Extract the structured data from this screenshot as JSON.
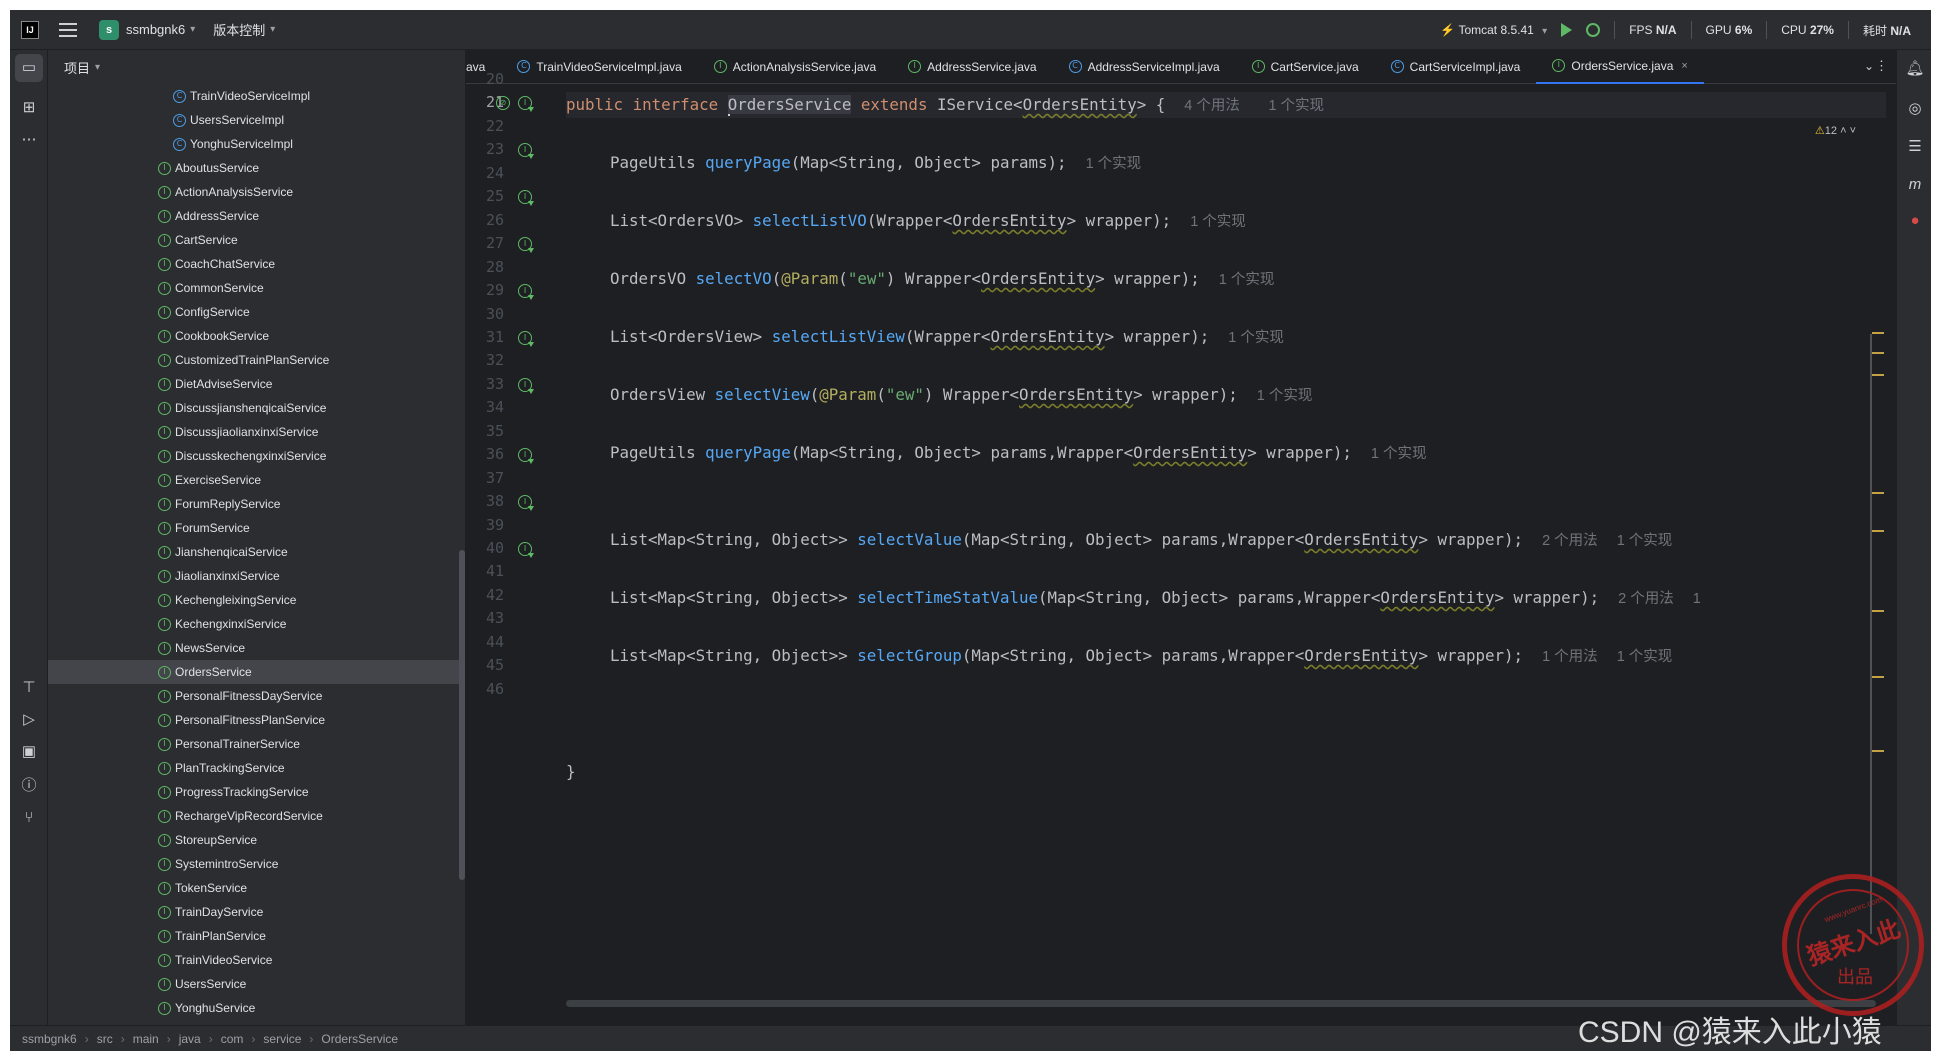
{
  "titlebar": {
    "project_initial": "s",
    "project_name": "ssmbgnk6",
    "vcs_label": "版本控制",
    "run_config": "Tomcat 8.5.41",
    "fps_label": "FPS",
    "fps_value": "N/A",
    "gpu_label": "GPU",
    "gpu_value": "6%",
    "cpu_label": "CPU",
    "cpu_value": "27%",
    "time_label": "耗时",
    "time_value": "N/A"
  },
  "project_panel": {
    "title": "项目",
    "items": [
      {
        "label": "TrainVideoServiceImpl",
        "kind": "class",
        "indent": 2
      },
      {
        "label": "UsersServiceImpl",
        "kind": "class",
        "indent": 2
      },
      {
        "label": "YonghuServiceImpl",
        "kind": "class",
        "indent": 2
      },
      {
        "label": "AboutusService",
        "kind": "interface",
        "indent": 1
      },
      {
        "label": "ActionAnalysisService",
        "kind": "interface",
        "indent": 1
      },
      {
        "label": "AddressService",
        "kind": "interface",
        "indent": 1
      },
      {
        "label": "CartService",
        "kind": "interface",
        "indent": 1
      },
      {
        "label": "CoachChatService",
        "kind": "interface",
        "indent": 1
      },
      {
        "label": "CommonService",
        "kind": "interface",
        "indent": 1
      },
      {
        "label": "ConfigService",
        "kind": "interface",
        "indent": 1
      },
      {
        "label": "CookbookService",
        "kind": "interface",
        "indent": 1
      },
      {
        "label": "CustomizedTrainPlanService",
        "kind": "interface",
        "indent": 1
      },
      {
        "label": "DietAdviseService",
        "kind": "interface",
        "indent": 1
      },
      {
        "label": "DiscussjianshenqicaiService",
        "kind": "interface",
        "indent": 1
      },
      {
        "label": "DiscussjiaolianxinxiService",
        "kind": "interface",
        "indent": 1
      },
      {
        "label": "DiscusskechengxinxiService",
        "kind": "interface",
        "indent": 1
      },
      {
        "label": "ExerciseService",
        "kind": "interface",
        "indent": 1
      },
      {
        "label": "ForumReplyService",
        "kind": "interface",
        "indent": 1
      },
      {
        "label": "ForumService",
        "kind": "interface",
        "indent": 1
      },
      {
        "label": "JianshenqicaiService",
        "kind": "interface",
        "indent": 1
      },
      {
        "label": "JiaolianxinxiService",
        "kind": "interface",
        "indent": 1
      },
      {
        "label": "KechengleixingService",
        "kind": "interface",
        "indent": 1
      },
      {
        "label": "KechengxinxiService",
        "kind": "interface",
        "indent": 1
      },
      {
        "label": "NewsService",
        "kind": "interface",
        "indent": 1
      },
      {
        "label": "OrdersService",
        "kind": "interface",
        "indent": 1,
        "selected": true
      },
      {
        "label": "PersonalFitnessDayService",
        "kind": "interface",
        "indent": 1
      },
      {
        "label": "PersonalFitnessPlanService",
        "kind": "interface",
        "indent": 1
      },
      {
        "label": "PersonalTrainerService",
        "kind": "interface",
        "indent": 1
      },
      {
        "label": "PlanTrackingService",
        "kind": "interface",
        "indent": 1
      },
      {
        "label": "ProgressTrackingService",
        "kind": "interface",
        "indent": 1
      },
      {
        "label": "RechargeVipRecordService",
        "kind": "interface",
        "indent": 1
      },
      {
        "label": "StoreupService",
        "kind": "interface",
        "indent": 1
      },
      {
        "label": "SystemintroService",
        "kind": "interface",
        "indent": 1
      },
      {
        "label": "TokenService",
        "kind": "interface",
        "indent": 1
      },
      {
        "label": "TrainDayService",
        "kind": "interface",
        "indent": 1
      },
      {
        "label": "TrainPlanService",
        "kind": "interface",
        "indent": 1
      },
      {
        "label": "TrainVideoService",
        "kind": "interface",
        "indent": 1
      },
      {
        "label": "UsersService",
        "kind": "interface",
        "indent": 1
      },
      {
        "label": "YonghuService",
        "kind": "interface",
        "indent": 1
      }
    ]
  },
  "tabs": [
    {
      "label": "ava",
      "kind": "none"
    },
    {
      "label": "TrainVideoServiceImpl.java",
      "kind": "class"
    },
    {
      "label": "ActionAnalysisService.java",
      "kind": "interface"
    },
    {
      "label": "AddressService.java",
      "kind": "interface"
    },
    {
      "label": "AddressServiceImpl.java",
      "kind": "class"
    },
    {
      "label": "CartService.java",
      "kind": "interface"
    },
    {
      "label": "CartServiceImpl.java",
      "kind": "class"
    },
    {
      "label": "OrdersService.java",
      "kind": "interface",
      "active": true
    }
  ],
  "editor": {
    "warning_count": "12",
    "line_numbers": [
      "20",
      "21",
      "22",
      "23",
      "24",
      "25",
      "26",
      "27",
      "28",
      "29",
      "30",
      "31",
      "32",
      "33",
      "34",
      "35",
      "36",
      "37",
      "38",
      "39",
      "40",
      "41",
      "42",
      "43",
      "44",
      "45",
      "46"
    ],
    "lines": {
      "l21": {
        "kw1": "public",
        "kw2": "interface",
        "name": "OrdersService",
        "kw3": "extends",
        "base": "IService<",
        "entity": "OrdersEntity",
        "tail": "> {",
        "hint1": "4 个用法",
        "hint2": "1 个实现"
      },
      "l23": {
        "pre": "PageUtils ",
        "fn": "queryPage",
        "args": "(Map<String, Object> params);",
        "hint": "1 个实现"
      },
      "l25": {
        "pre": "List<OrdersVO> ",
        "fn": "selectListVO",
        "a1": "(Wrapper<",
        "entity": "OrdersEntity",
        "a2": "> wrapper);",
        "hint": "1 个实现"
      },
      "l27": {
        "pre": "OrdersVO ",
        "fn": "selectVO",
        "p": "(",
        "an": "@Param",
        "s1": "(",
        "str": "\"ew\"",
        "s2": ") Wrapper<",
        "entity": "OrdersEntity",
        "a2": "> wrapper);",
        "hint": "1 个实现"
      },
      "l29": {
        "pre": "List<OrdersView> ",
        "fn": "selectListView",
        "a1": "(Wrapper<",
        "entity": "OrdersEntity",
        "a2": "> wrapper);",
        "hint": "1 个实现"
      },
      "l31": {
        "pre": "OrdersView ",
        "fn": "selectView",
        "p": "(",
        "an": "@Param",
        "s1": "(",
        "str": "\"ew\"",
        "s2": ") Wrapper<",
        "entity": "OrdersEntity",
        "a2": "> wrapper);",
        "hint": "1 个实现"
      },
      "l33": {
        "pre": "PageUtils ",
        "fn": "queryPage",
        "a1": "(Map<String, Object> params,Wrapper<",
        "entity": "OrdersEntity",
        "a2": "> wrapper);",
        "hint": "1 个实现"
      },
      "l36": {
        "pre": "List<Map<String, Object>> ",
        "fn": "selectValue",
        "a1": "(Map<String, Object> params,Wrapper<",
        "entity": "OrdersEntity",
        "a2": "> wrapper);",
        "hint1": "2 个用法",
        "hint2": "1 个实现"
      },
      "l38": {
        "pre": "List<Map<String, Object>> ",
        "fn": "selectTimeStatValue",
        "a1": "(Map<String, Object> params,Wrapper<",
        "entity": "OrdersEntity",
        "a2": "> wrapper);",
        "hint1": "2 个用法",
        "hint2": "1"
      },
      "l40": {
        "pre": "List<Map<String, Object>> ",
        "fn": "selectGroup",
        "a1": "(Map<String, Object> params,Wrapper<",
        "entity": "OrdersEntity",
        "a2": "> wrapper);",
        "hint1": "1 个用法",
        "hint2": "1 个实现"
      },
      "l44": {
        "text": "}"
      }
    }
  },
  "statusbar": {
    "crumbs": [
      "ssmbgnk6",
      "src",
      "main",
      "java",
      "com",
      "service",
      "OrdersService"
    ]
  },
  "watermark": {
    "stamp_top": "www.yuanrc.com",
    "stamp_main": "猿来入此",
    "stamp_sub": "出品",
    "csdn": "CSDN @猿来入此小猿"
  },
  "colors": {
    "background": "#1e1f22",
    "panel": "#2b2d30",
    "keyword": "#cf8e6d",
    "function": "#56a8f5",
    "annotation": "#b3ae60",
    "string": "#6aab73",
    "accent": "#3574f0"
  }
}
